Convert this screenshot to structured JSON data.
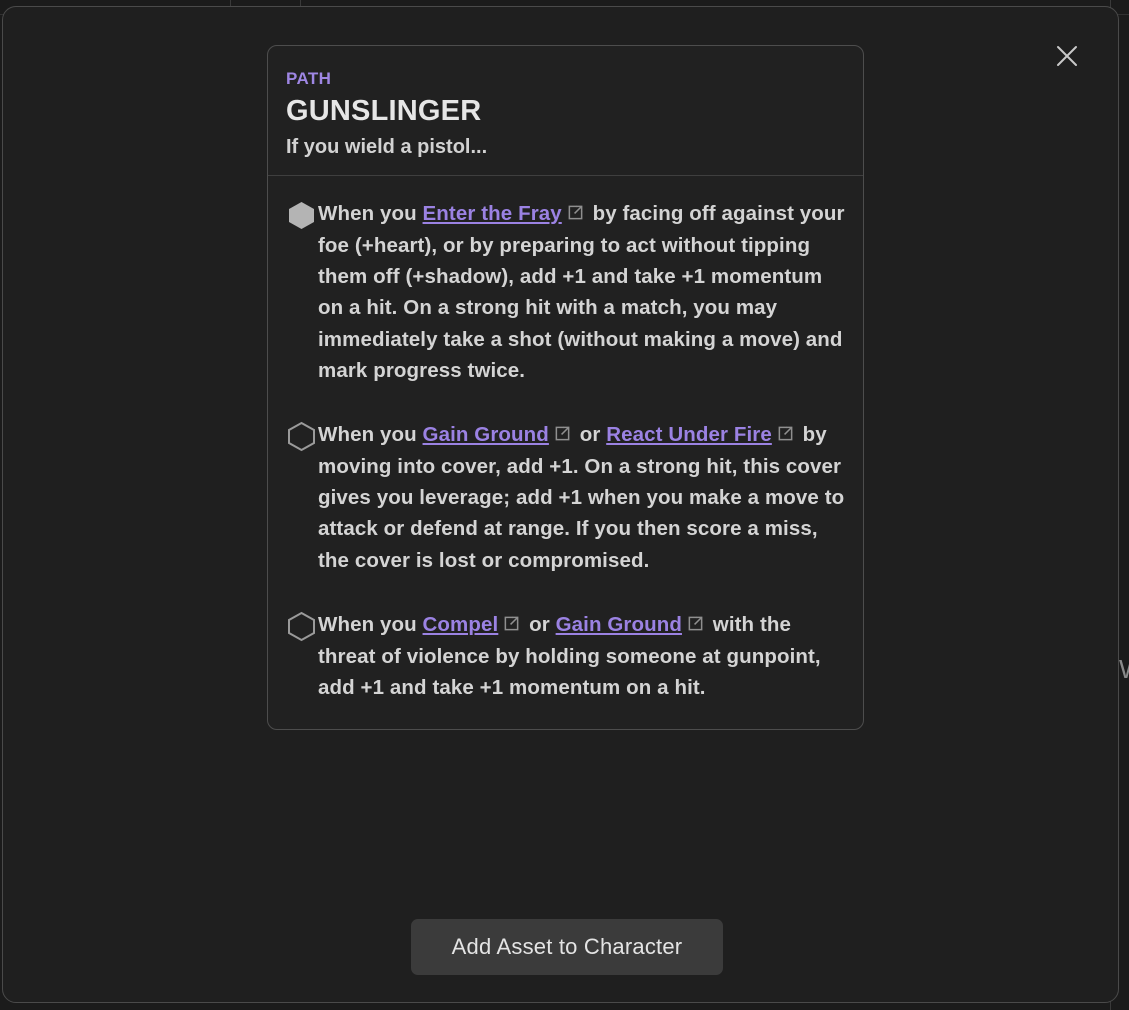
{
  "modal": {
    "close_label": "×",
    "close_icon": "close-icon"
  },
  "asset": {
    "type": "PATH",
    "title": "GUNSLINGER",
    "subtitle": "If you wield a pistol...",
    "type_color": "#9e86e3",
    "link_color": "#9b82e3",
    "abilities": [
      {
        "enabled": true,
        "marker": "hexagon-filled",
        "segments": [
          {
            "kind": "text",
            "value": "When you "
          },
          {
            "kind": "link",
            "value": "Enter the Fray"
          },
          {
            "kind": "icon",
            "value": "external-link-icon"
          },
          {
            "kind": "text",
            "value": " by facing off against your foe (+heart), or by preparing to act without tipping them off (+shadow), add +1 and take +1 momentum on a hit. On a strong hit with a match, you may immediately take a shot (without making a move) and mark progress twice."
          }
        ]
      },
      {
        "enabled": false,
        "marker": "hexagon-outline",
        "segments": [
          {
            "kind": "text",
            "value": "When you "
          },
          {
            "kind": "link",
            "value": "Gain Ground"
          },
          {
            "kind": "icon",
            "value": "external-link-icon"
          },
          {
            "kind": "text",
            "value": " or "
          },
          {
            "kind": "link",
            "value": "React Under Fire"
          },
          {
            "kind": "icon",
            "value": "external-link-icon"
          },
          {
            "kind": "text",
            "value": " by moving into cover, add +1. On a strong hit, this cover gives you leverage; add +1 when you make a move to attack or defend at range. If you then score a miss, the cover is lost or compromised."
          }
        ]
      },
      {
        "enabled": false,
        "marker": "hexagon-outline",
        "segments": [
          {
            "kind": "text",
            "value": "When you "
          },
          {
            "kind": "link",
            "value": "Compel"
          },
          {
            "kind": "icon",
            "value": "external-link-icon"
          },
          {
            "kind": "text",
            "value": " or "
          },
          {
            "kind": "link",
            "value": "Gain Ground"
          },
          {
            "kind": "icon",
            "value": "external-link-icon"
          },
          {
            "kind": "text",
            "value": " with the threat of violence by holding someone at gunpoint, add +1 and take +1 momentum on a hit."
          }
        ]
      }
    ]
  },
  "footer": {
    "add_button_label": "Add Asset to Character"
  }
}
